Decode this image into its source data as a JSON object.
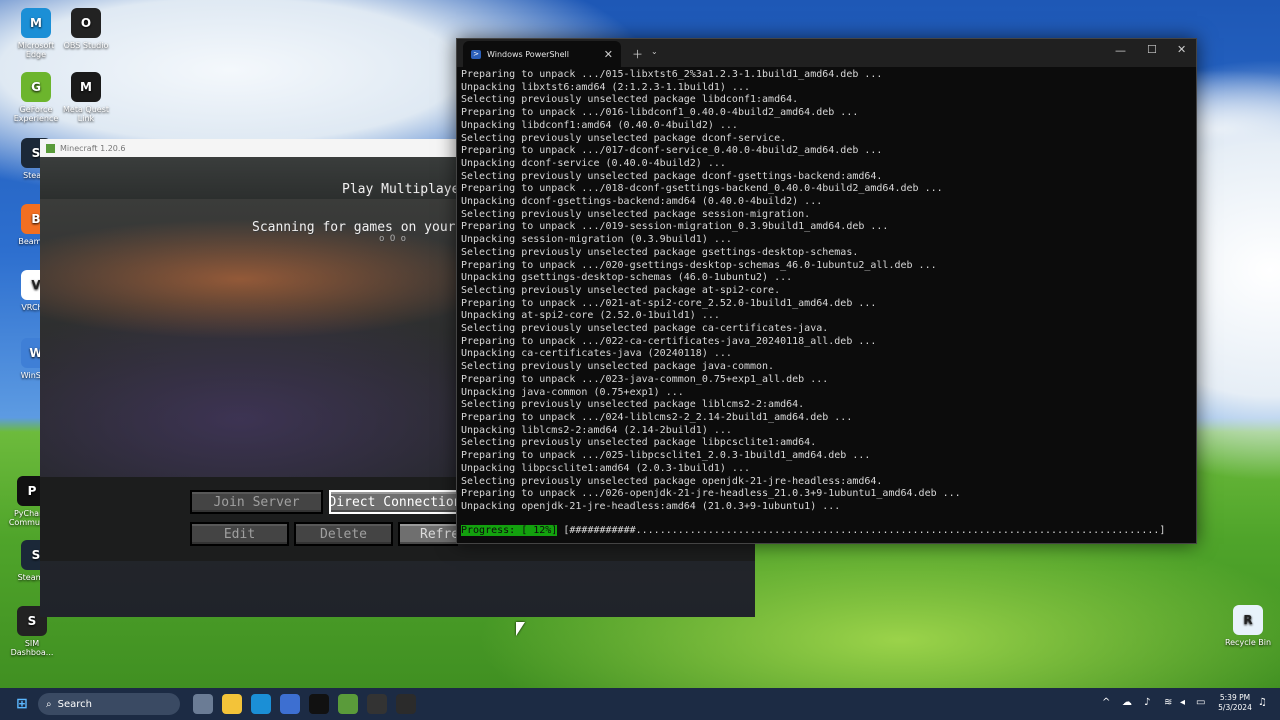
{
  "desktop": {
    "icons": [
      {
        "label": "Microsoft Edge",
        "icon": "edge-icon",
        "color": "#1b8fd6"
      },
      {
        "label": "OBS Studio",
        "icon": "obs-icon",
        "color": "#222222"
      },
      {
        "label": "GeForce Experience",
        "icon": "geforce-icon",
        "color": "#6cb52d"
      },
      {
        "label": "Meta Quest Link",
        "icon": "meta-icon",
        "color": "#1a1a1a"
      },
      {
        "label": "Steam",
        "icon": "steam-icon",
        "color": "#1b2838"
      },
      {
        "label": "BeamNG",
        "icon": "beamng-icon",
        "color": "#f26f21"
      },
      {
        "label": "VRChat",
        "icon": "vrchat-icon",
        "color": "#ffffff"
      },
      {
        "label": "WinSCP",
        "icon": "winscp-icon",
        "color": "#3f7fd6"
      },
      {
        "label": "PyCharm Community",
        "icon": "pycharm-icon",
        "color": "#111111"
      },
      {
        "label": "SteamVR",
        "icon": "steamvr-icon",
        "color": "#1b2838"
      },
      {
        "label": "SIM Dashboa...",
        "icon": "sim-dashboard-icon",
        "color": "#222222"
      },
      {
        "label": "Recycle Bin",
        "icon": "recycle-bin-icon",
        "color": "#e8f2fb"
      }
    ]
  },
  "minecraft": {
    "window_title": "Minecraft 1.20.6",
    "screen_title": "Play Multiplayer",
    "scanning_text": "Scanning for games on your l",
    "scan_dots": "o O o",
    "buttons": {
      "join": "Join Server",
      "direct": "Direct Connection",
      "edit": "Edit",
      "delete": "Delete",
      "refresh": "Refre"
    }
  },
  "terminal": {
    "tab_title": "Windows PowerShell",
    "lines": [
      "Preparing to unpack .../015-libxtst6_2%3a1.2.3-1.1build1_amd64.deb ...",
      "Unpacking libxtst6:amd64 (2:1.2.3-1.1build1) ...",
      "Selecting previously unselected package libdconf1:amd64.",
      "Preparing to unpack .../016-libdconf1_0.40.0-4build2_amd64.deb ...",
      "Unpacking libdconf1:amd64 (0.40.0-4build2) ...",
      "Selecting previously unselected package dconf-service.",
      "Preparing to unpack .../017-dconf-service_0.40.0-4build2_amd64.deb ...",
      "Unpacking dconf-service (0.40.0-4build2) ...",
      "Selecting previously unselected package dconf-gsettings-backend:amd64.",
      "Preparing to unpack .../018-dconf-gsettings-backend_0.40.0-4build2_amd64.deb ...",
      "Unpacking dconf-gsettings-backend:amd64 (0.40.0-4build2) ...",
      "Selecting previously unselected package session-migration.",
      "Preparing to unpack .../019-session-migration_0.3.9build1_amd64.deb ...",
      "Unpacking session-migration (0.3.9build1) ...",
      "Selecting previously unselected package gsettings-desktop-schemas.",
      "Preparing to unpack .../020-gsettings-desktop-schemas_46.0-1ubuntu2_all.deb ...",
      "Unpacking gsettings-desktop-schemas (46.0-1ubuntu2) ...",
      "Selecting previously unselected package at-spi2-core.",
      "Preparing to unpack .../021-at-spi2-core_2.52.0-1build1_amd64.deb ...",
      "Unpacking at-spi2-core (2.52.0-1build1) ...",
      "Selecting previously unselected package ca-certificates-java.",
      "Preparing to unpack .../022-ca-certificates-java_20240118_all.deb ...",
      "Unpacking ca-certificates-java (20240118) ...",
      "Selecting previously unselected package java-common.",
      "Preparing to unpack .../023-java-common_0.75+exp1_all.deb ...",
      "Unpacking java-common (0.75+exp1) ...",
      "Selecting previously unselected package liblcms2-2:amd64.",
      "Preparing to unpack .../024-liblcms2-2_2.14-2build1_amd64.deb ...",
      "Unpacking liblcms2-2:amd64 (2.14-2build1) ...",
      "Selecting previously unselected package libpcsclite1:amd64.",
      "Preparing to unpack .../025-libpcsclite1_2.0.3-1build1_amd64.deb ...",
      "Unpacking libpcsclite1:amd64 (2.0.3-1build1) ...",
      "Selecting previously unselected package openjdk-21-jre-headless:amd64.",
      "Preparing to unpack .../026-openjdk-21-jre-headless_21.0.3+9-1ubuntu1_amd64.deb ...",
      "Unpacking openjdk-21-jre-headless:amd64 (21.0.3+9-1ubuntu1) ..."
    ],
    "progress_label": "Progress: [ 12%]",
    "progress_bar": "[###########.......................................................................................]",
    "progress_fraction": 0.12
  },
  "taskbar": {
    "search_label": "Search",
    "apps": [
      {
        "icon": "task-view-icon",
        "color": "#6b7c95"
      },
      {
        "icon": "file-explorer-icon",
        "color": "#f3c339"
      },
      {
        "icon": "edge-icon",
        "color": "#1b8fd6"
      },
      {
        "icon": "store-icon",
        "color": "#3d6fd1"
      },
      {
        "icon": "pycharm-icon",
        "color": "#111111"
      },
      {
        "icon": "minecraft-icon",
        "color": "#5a9b3a"
      },
      {
        "icon": "obs-icon",
        "color": "#333333"
      },
      {
        "icon": "terminal-icon",
        "color": "#2b2b2b"
      }
    ],
    "time": "5:39 PM",
    "date": "5/3/2024"
  }
}
